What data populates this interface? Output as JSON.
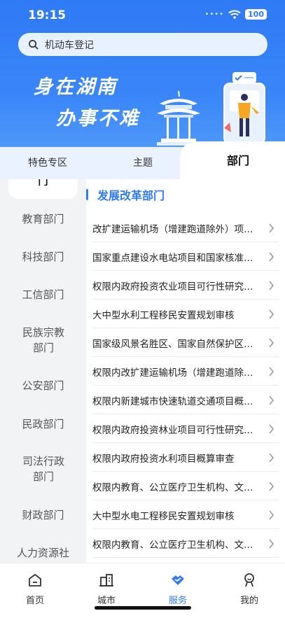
{
  "status_bar": {
    "time": "19:15",
    "signal": "••••",
    "battery": "100"
  },
  "search": {
    "value": "机动车登记",
    "icon": "search-icon"
  },
  "banner": {
    "line1": "身在湖南",
    "line2": "办事不难"
  },
  "tabs": [
    {
      "label": "特色专区",
      "active": false
    },
    {
      "label": "主题",
      "active": false
    },
    {
      "label": "部门",
      "active": true
    }
  ],
  "sidebar": {
    "selected_partial": "门",
    "items": [
      "教育部门",
      "科技部门",
      "工信部门",
      "民族宗教部门",
      "公安部门",
      "民政部门",
      "司法行政部门",
      "财政部门",
      "人力资源社"
    ]
  },
  "section": {
    "title": "发展改革部门"
  },
  "services": [
    "改扩建运输机场（增建跑道除外）项目核准",
    "国家重点建设水电站项目和国家核准（审批）",
    "权限内政府投资农业项目可行性研究报告审批",
    "大中型水利工程移民安置规划审核",
    "国家级风景名胜区、国家自然保护区、全国重点",
    "权限内改扩建运输机场（增建跑道除外）项目",
    "权限内新建城市快速轨道交通项目概算审批",
    "权限内政府投资林业项目可行性研究报告审批",
    "权限内政府投资水利项目概算审查",
    "权限内教育、公立医疗卫生机构、文化设施项目",
    "大中型水电工程移民安置规划审核",
    "权限内教育、公立医疗卫生机构、文化设施项目"
  ],
  "tabbar": [
    {
      "label": "首页",
      "icon": "home-icon",
      "active": false
    },
    {
      "label": "城市",
      "icon": "city-icon",
      "active": false
    },
    {
      "label": "服务",
      "icon": "service-icon",
      "active": true
    },
    {
      "label": "我的",
      "icon": "profile-icon",
      "active": false
    }
  ],
  "colors": {
    "primary": "#2f7af6",
    "sidebar_bg": "#f2f3f5"
  }
}
